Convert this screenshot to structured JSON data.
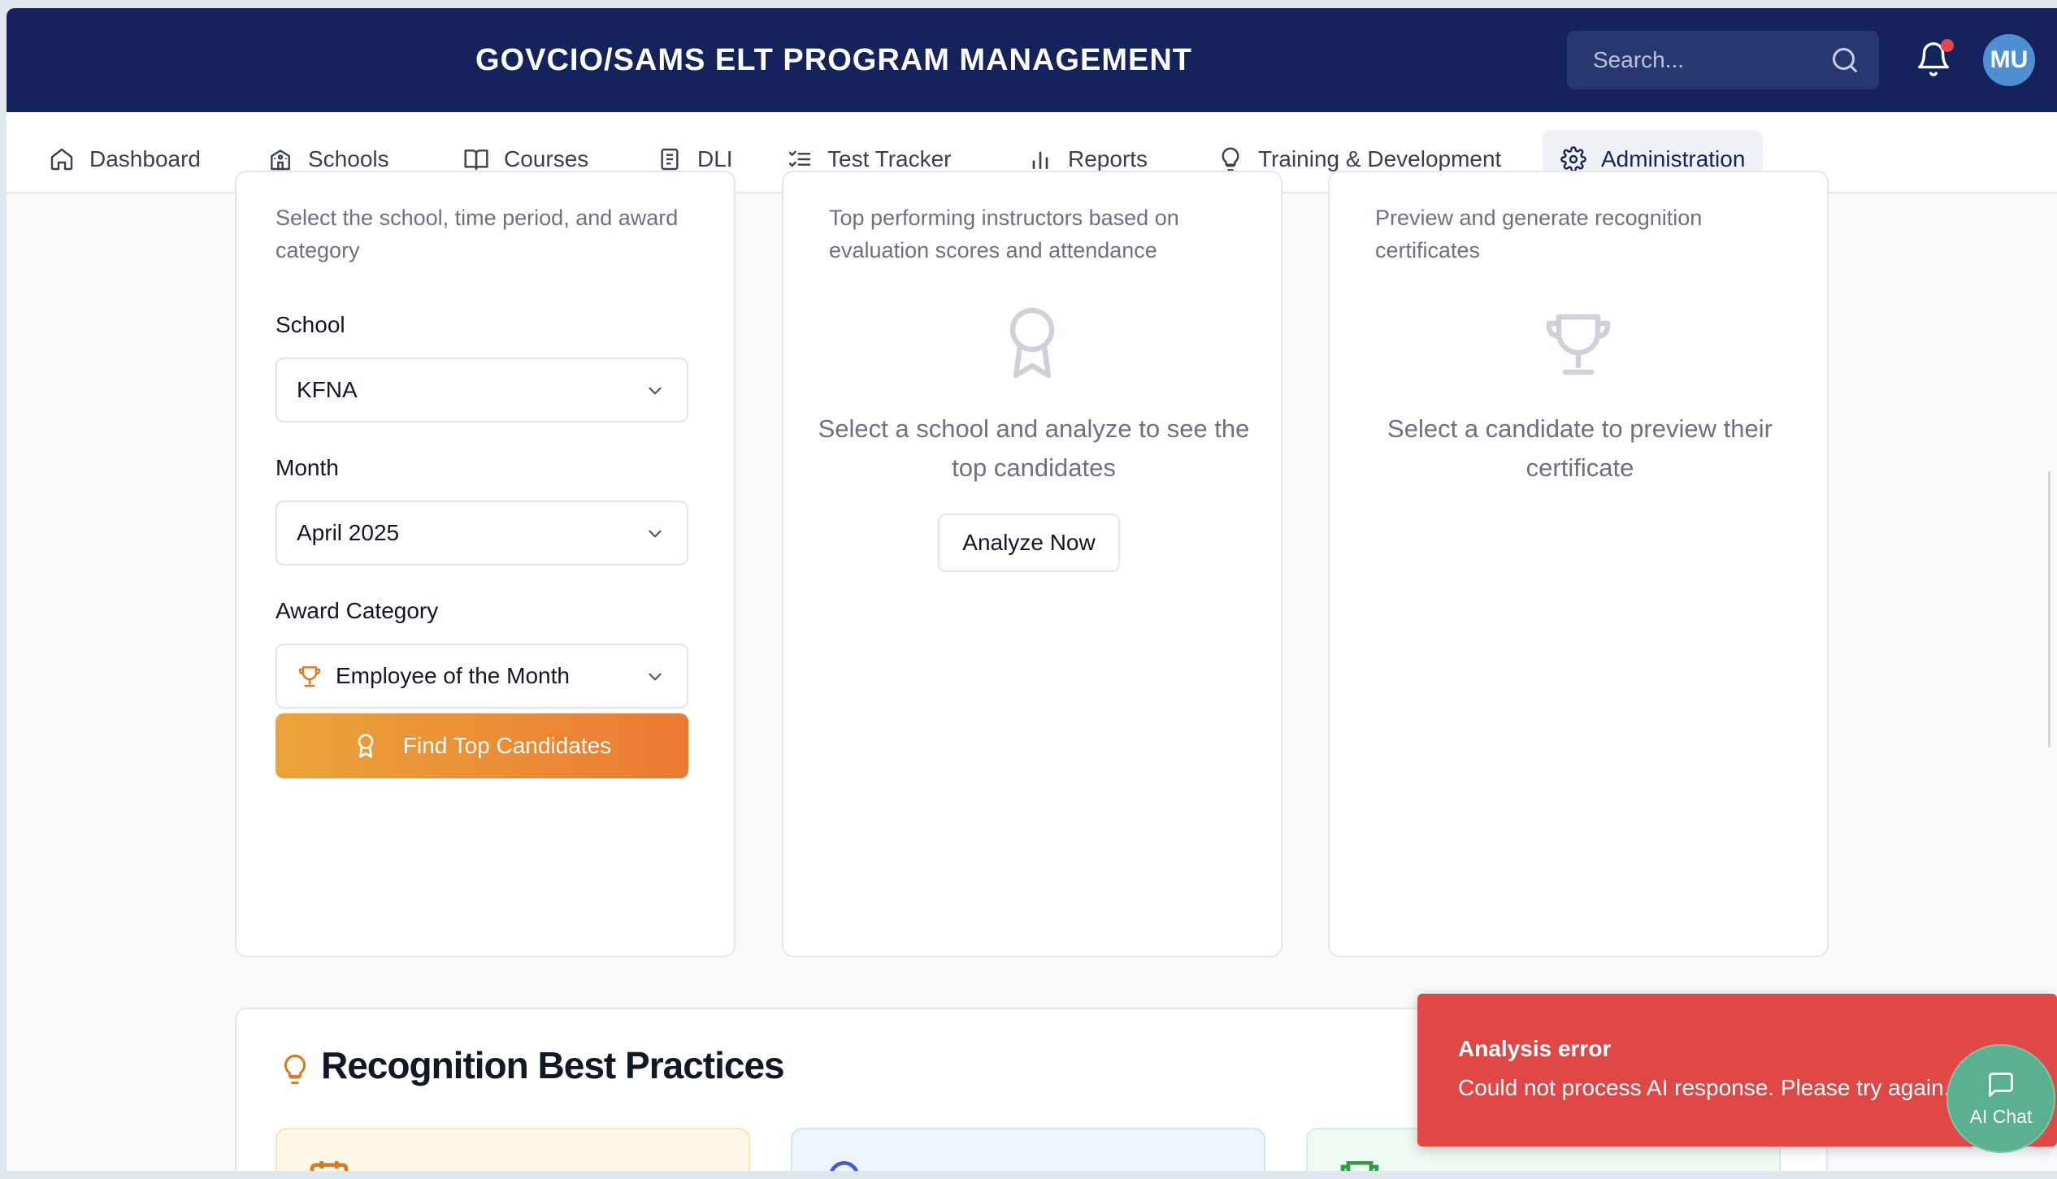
{
  "header": {
    "title": "GOVCIO/SAMS ELT PROGRAM MANAGEMENT",
    "search_placeholder": "Search...",
    "avatar_initials": "MU"
  },
  "nav": {
    "items": [
      {
        "label": "Dashboard",
        "icon": "home-icon"
      },
      {
        "label": "Schools",
        "icon": "school-icon"
      },
      {
        "label": "Courses",
        "icon": "book-icon"
      },
      {
        "label": "DLI",
        "icon": "document-icon"
      },
      {
        "label": "Test Tracker",
        "icon": "checklist-icon"
      },
      {
        "label": "Reports",
        "icon": "bar-chart-icon"
      },
      {
        "label": "Training & Development",
        "icon": "lightbulb-icon"
      },
      {
        "label": "Administration",
        "icon": "gear-icon",
        "active": true
      }
    ]
  },
  "selection_card": {
    "description": "Select the school, time period, and award category",
    "school_label": "School",
    "school_value": "KFNA",
    "month_label": "Month",
    "month_value": "April 2025",
    "category_label": "Award Category",
    "category_value": "Employee of the Month",
    "find_button": "Find Top Candidates"
  },
  "candidates_card": {
    "description": "Top performing instructors based on evaluation scores and attendance",
    "empty_text": "Select a school and analyze to see the top candidates",
    "analyze_button": "Analyze Now"
  },
  "certificate_card": {
    "description": "Preview and generate recognition certificates",
    "empty_text": "Select a candidate to preview their certificate"
  },
  "best_practices": {
    "title": "Recognition Best Practices"
  },
  "toast": {
    "title": "Analysis error",
    "message": "Could not process AI response. Please try again."
  },
  "ai_chat": {
    "label": "AI Chat"
  },
  "colors": {
    "header_bg": "#14235c",
    "accent_orange": "#eb8a36",
    "error_red": "#e04848",
    "chat_green": "#5bb08f"
  }
}
